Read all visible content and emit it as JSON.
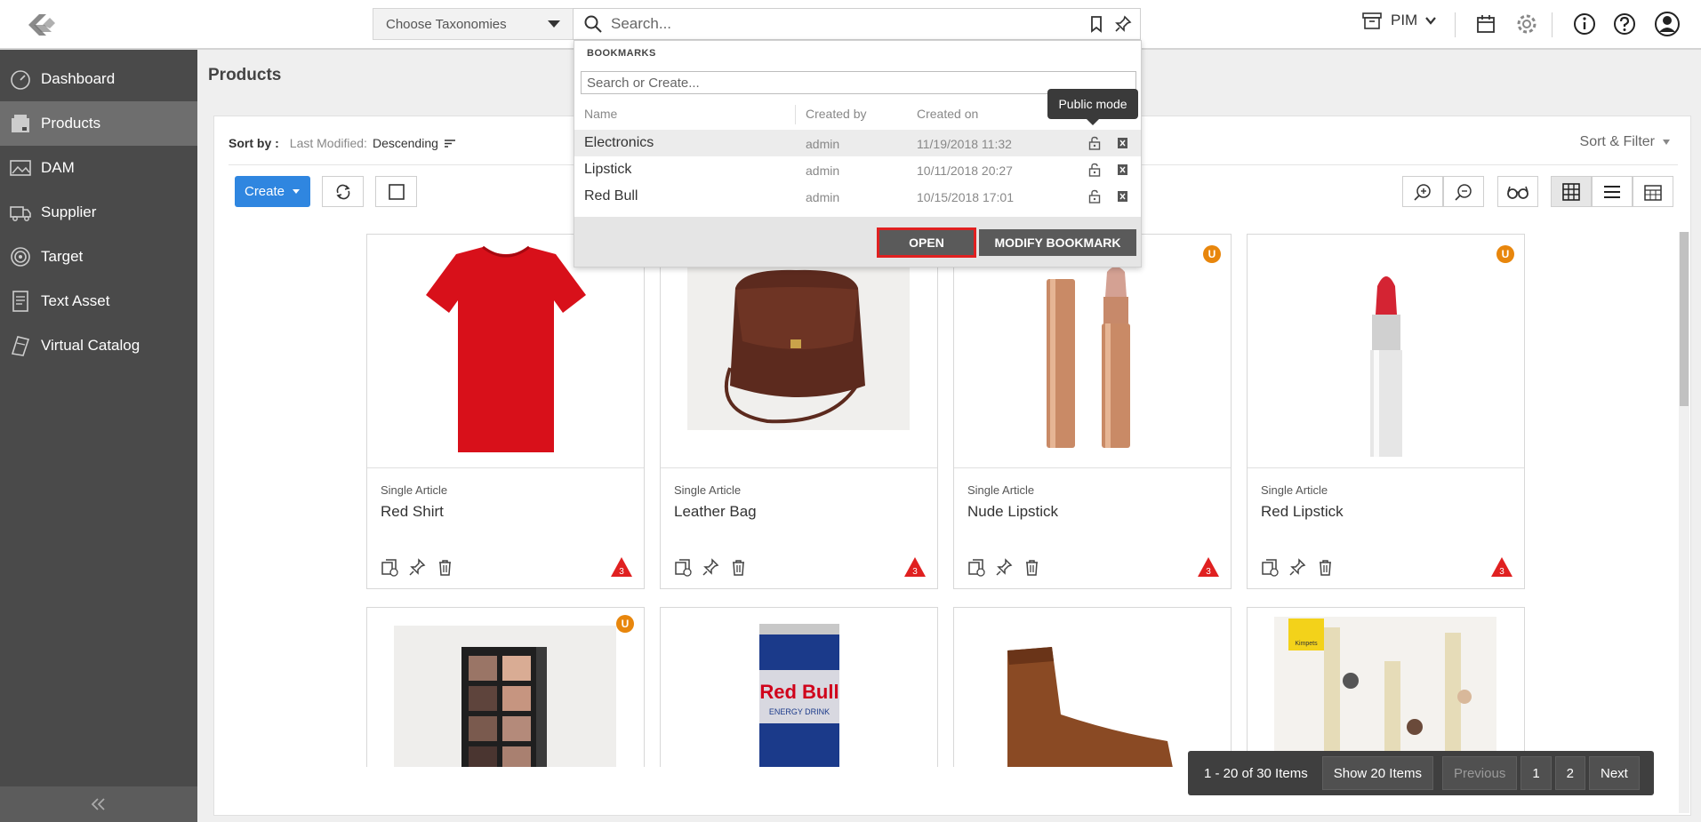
{
  "topbar": {
    "taxonomy_label": "Choose Taxonomies",
    "search_placeholder": "Search...",
    "module": "PIM"
  },
  "sidebar": {
    "items": [
      {
        "label": "Dashboard",
        "icon": "dashboard-icon"
      },
      {
        "label": "Products",
        "icon": "products-icon",
        "active": true
      },
      {
        "label": "DAM",
        "icon": "image-icon"
      },
      {
        "label": "Supplier",
        "icon": "truck-icon"
      },
      {
        "label": "Target",
        "icon": "target-icon"
      },
      {
        "label": "Text Asset",
        "icon": "document-icon"
      },
      {
        "label": "Virtual Catalog",
        "icon": "catalog-icon"
      }
    ]
  },
  "main": {
    "title": "Products",
    "sort_label": "Sort by :",
    "sort_field": "Last Modified:",
    "sort_order": "Descending",
    "sort_filter": "Sort & Filter",
    "create_label": "Create"
  },
  "bookmarks": {
    "header": "BOOKMARKS",
    "search_placeholder": "Search or Create...",
    "columns": [
      "Name",
      "Created by",
      "Created on"
    ],
    "rows": [
      {
        "name": "Electronics",
        "by": "admin",
        "on": "11/19/2018 11:32"
      },
      {
        "name": "Lipstick",
        "by": "admin",
        "on": "10/11/2018 20:27"
      },
      {
        "name": "Red Bull",
        "by": "admin",
        "on": "10/15/2018 17:01"
      }
    ],
    "tooltip": "Public mode",
    "open_label": "OPEN",
    "modify_label": "MODIFY BOOKMARK"
  },
  "products": [
    {
      "type": "Single Article",
      "name": "Red Shirt",
      "warn": "3"
    },
    {
      "type": "Single Article",
      "name": "Leather Bag",
      "warn": "3"
    },
    {
      "type": "Single Article",
      "name": "Nude Lipstick",
      "warn": "3",
      "badge": "U"
    },
    {
      "type": "Single Article",
      "name": "Red Lipstick",
      "warn": "3",
      "badge": "U"
    }
  ],
  "second_row_badge": "U",
  "kimpets_label": "Kimpets",
  "redbull_text": "Red Bull",
  "redbull_sub": "ENERGY DRINK",
  "pager": {
    "range": "1 - 20 of 30 Items",
    "show": "Show 20 Items",
    "prev": "Previous",
    "pages": [
      "1",
      "2"
    ],
    "next": "Next"
  },
  "colors": {
    "accent": "#2f86e0",
    "sidebar": "#4a4a4a",
    "badge": "#e8860c",
    "warn": "#e02020"
  }
}
